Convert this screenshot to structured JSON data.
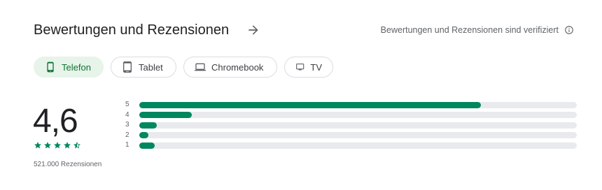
{
  "header": {
    "title": "Bewertungen und Rezensionen",
    "verified_text": "Bewertungen und Rezensionen sind verifiziert"
  },
  "device_chips": [
    {
      "label": "Telefon",
      "icon": "phone-icon",
      "selected": true
    },
    {
      "label": "Tablet",
      "icon": "tablet-icon",
      "selected": false
    },
    {
      "label": "Chromebook",
      "icon": "laptop-icon",
      "selected": false
    },
    {
      "label": "TV",
      "icon": "tv-icon",
      "selected": false
    }
  ],
  "summary": {
    "rating": "4,6",
    "stars_filled": 4.5,
    "review_count": "521.000 Rezensionen"
  },
  "histogram": [
    {
      "label": "5",
      "share": 0.78
    },
    {
      "label": "4",
      "share": 0.12
    },
    {
      "label": "3",
      "share": 0.04
    },
    {
      "label": "2",
      "share": 0.02
    },
    {
      "label": "1",
      "share": 0.035
    }
  ],
  "colors": {
    "accent": "#01875f",
    "chip_selected_bg": "#e6f4ea",
    "chip_selected_text": "#137333",
    "track": "#e8eaed"
  }
}
